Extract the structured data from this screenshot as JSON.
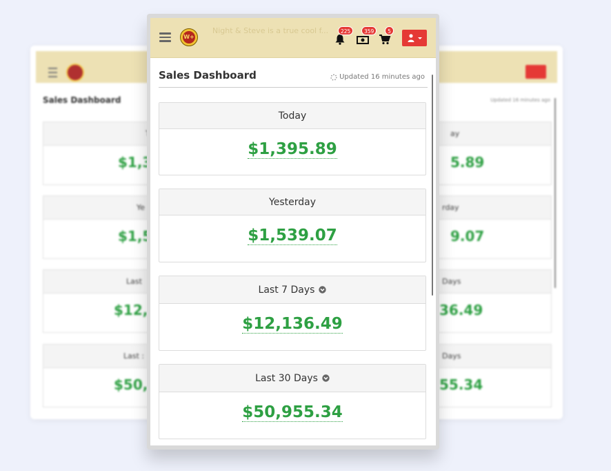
{
  "app": {
    "header_ghost_text": "Night & Steve is a true cool f...",
    "logo_text": "W+",
    "notifications_count": "225",
    "money_count": "359",
    "cart_count": "5"
  },
  "dashboard": {
    "title": "Sales Dashboard",
    "updated": "Updated 16 minutes ago",
    "cards": [
      {
        "label": "Today",
        "amount": "$1,395.89",
        "has_dropdown": false
      },
      {
        "label": "Yesterday",
        "amount": "$1,539.07",
        "has_dropdown": false
      },
      {
        "label": "Last 7 Days",
        "amount": "$12,136.49",
        "has_dropdown": true
      },
      {
        "label": "Last 30 Days",
        "amount": "$50,955.34",
        "has_dropdown": true
      }
    ]
  },
  "background": {
    "title": "Sales Dashboard",
    "updated": "Updated 16 minutes ago",
    "left_labels": [
      "T",
      "Ye",
      "Last",
      "Last :"
    ],
    "left_amounts": [
      "$1,3",
      "$1,5",
      "$12,",
      "$50,"
    ],
    "right_labels": [
      "ay",
      "rday",
      "Days",
      "Days"
    ],
    "right_amounts": [
      "5.89",
      "9.07",
      "36.49",
      "55.34"
    ]
  },
  "colors": {
    "header_bg": "#ede1b4",
    "amount_green": "#2ea043",
    "badge_red": "#e53935",
    "page_bg": "#eef1fb"
  },
  "icons": {
    "menu": "hamburger-icon",
    "notifications": "bell-icon",
    "money": "money-icon",
    "cart": "cart-icon",
    "user": "user-icon",
    "updated": "spinner-icon",
    "dropdown": "chevron-circle-down-icon"
  }
}
